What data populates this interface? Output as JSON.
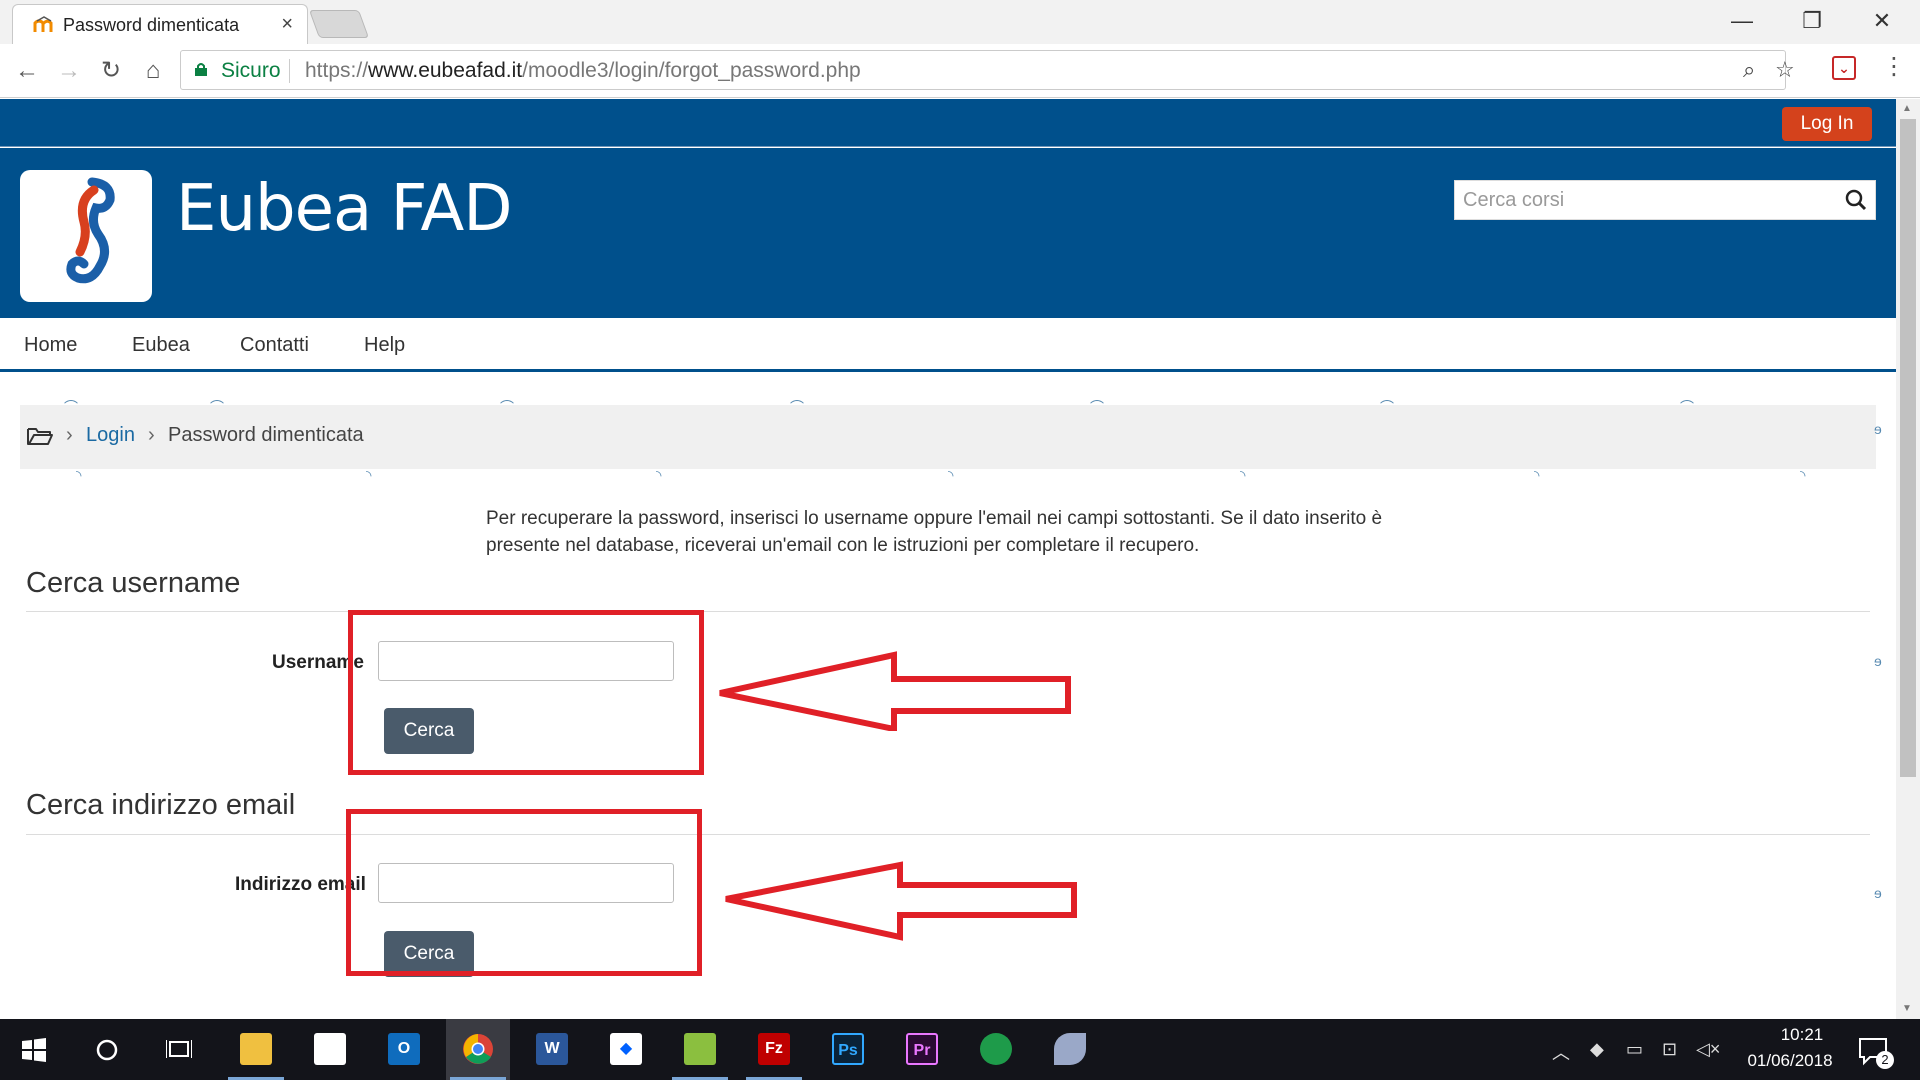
{
  "browser": {
    "tab_title": "Password dimenticata",
    "tab_close": "×",
    "secure_label": "Sicuro",
    "url_scheme": "https://",
    "url_host": "www.eubeafad.it",
    "url_path": "/moodle3/login/forgot_password.php",
    "window_controls": {
      "minimize": "—",
      "restore": "❐",
      "close": "✕"
    },
    "nav": {
      "back": "←",
      "forward": "→",
      "reload": "↻",
      "home": "⌂"
    },
    "zoom_icon": "⌕",
    "star_icon": "☆",
    "menu_icon": "⋮"
  },
  "site": {
    "login_label": "Log In",
    "name": "Eubea FAD",
    "search_placeholder": "Cerca corsi",
    "nav": [
      "Home",
      "Eubea",
      "Contatti",
      "Help"
    ]
  },
  "breadcrumb": {
    "sep": "›",
    "link": "Login",
    "current": "Password dimenticata"
  },
  "intro_text": "Per recuperare la password, inserisci lo username oppure l'email nei campi sottostanti. Se il dato inserito è presente nel database, riceverai un'email con le istruzioni per completare il recupero.",
  "forms": {
    "username": {
      "title": "Cerca username",
      "label": "Username",
      "value": "",
      "button": "Cerca"
    },
    "email": {
      "title": "Cerca indirizzo email",
      "label": "Indirizzo email",
      "value": "",
      "button": "Cerca"
    }
  },
  "annotation_color": "#e02027",
  "brand_color": "#00508c",
  "taskbar": {
    "clock_time": "10:21",
    "clock_date": "01/06/2018",
    "notification_count": "2",
    "apps": [
      {
        "icon": "file-explorer-icon",
        "glyph": "",
        "color": "#f0c040"
      },
      {
        "icon": "store-icon",
        "glyph": "",
        "color": "#ffffff"
      },
      {
        "icon": "outlook-icon",
        "glyph": "O",
        "color": "#0f6cbd"
      },
      {
        "icon": "chrome-icon",
        "glyph": "",
        "color": "#db4437"
      },
      {
        "icon": "word-icon",
        "glyph": "W",
        "color": "#2b579a"
      },
      {
        "icon": "dropbox-icon",
        "glyph": "◆",
        "color": "#ffffff"
      },
      {
        "icon": "notepad-plus-icon",
        "glyph": "",
        "color": "#8bbf3f"
      },
      {
        "icon": "filezilla-icon",
        "glyph": "Fz",
        "color": "#bf0000"
      },
      {
        "icon": "photoshop-icon",
        "glyph": "Ps",
        "color": "#0a2238"
      },
      {
        "icon": "premiere-icon",
        "glyph": "Pr",
        "color": "#2a0a33"
      },
      {
        "icon": "sync-icon",
        "glyph": "",
        "color": "#1e9b4a"
      },
      {
        "icon": "feather-icon",
        "glyph": "",
        "color": "#9aa8c8"
      }
    ]
  }
}
